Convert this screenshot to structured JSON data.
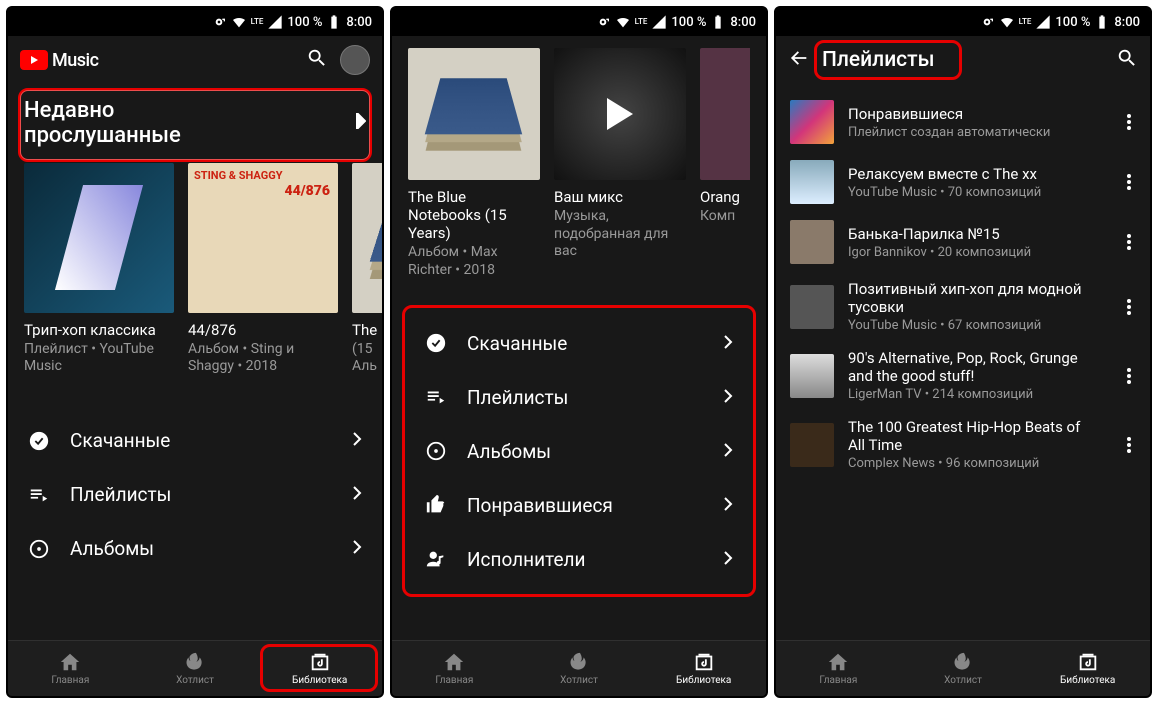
{
  "statusbar": {
    "time": "8:00",
    "battery": "100 %",
    "net": "LTE"
  },
  "brand": "Music",
  "screen1": {
    "recent_title_l1": "Недавно",
    "recent_title_l2": "прослушанные",
    "cards": [
      {
        "title": "Трип-хоп классика",
        "sub": "Плейлист • YouTube Music"
      },
      {
        "title": "44/876",
        "sub": "Альбом • Sting и Shaggy • 2018"
      },
      {
        "title": "The",
        "sub": "(15\nАль"
      }
    ],
    "menu": [
      {
        "icon": "download",
        "label": "Скачанные"
      },
      {
        "icon": "playlist",
        "label": "Плейлисты"
      },
      {
        "icon": "album",
        "label": "Альбомы"
      }
    ]
  },
  "screen2": {
    "cards": [
      {
        "title": "The Blue Notebooks (15 Years)",
        "sub": "Альбом • Max Richter • 2018"
      },
      {
        "title": "Ваш микс",
        "sub": "Музыка, подобранная для вас"
      },
      {
        "title": "Orang",
        "sub": "Комп"
      }
    ],
    "menu": [
      {
        "icon": "download",
        "label": "Скачанные"
      },
      {
        "icon": "playlist",
        "label": "Плейлисты"
      },
      {
        "icon": "album",
        "label": "Альбомы"
      },
      {
        "icon": "like",
        "label": "Понравившиеся"
      },
      {
        "icon": "artist",
        "label": "Исполнители"
      }
    ]
  },
  "screen3": {
    "title": "Плейлисты",
    "rows": [
      {
        "title": "Понравившиеся",
        "sub": "Плейлист создан автоматически"
      },
      {
        "title": "Релаксуем вместе с The xx",
        "sub": "YouTube Music • 70 композиций"
      },
      {
        "title": "Банька-Парилка №15",
        "sub": "Igor Bannikov • 20 композиций"
      },
      {
        "title": "Позитивный хип-хоп для модной тусовки",
        "sub": "YouTube Music • 67 композиций"
      },
      {
        "title": "90's Alternative, Pop, Rock, Grunge and the good stuff!",
        "sub": "LigerMan TV • 214 композиций"
      },
      {
        "title": "The 100 Greatest Hip-Hop Beats of All Time",
        "sub": "Complex News • 96 композиций"
      }
    ]
  },
  "botnav": {
    "home": "Главная",
    "hot": "Хотлист",
    "lib": "Библиотека"
  }
}
